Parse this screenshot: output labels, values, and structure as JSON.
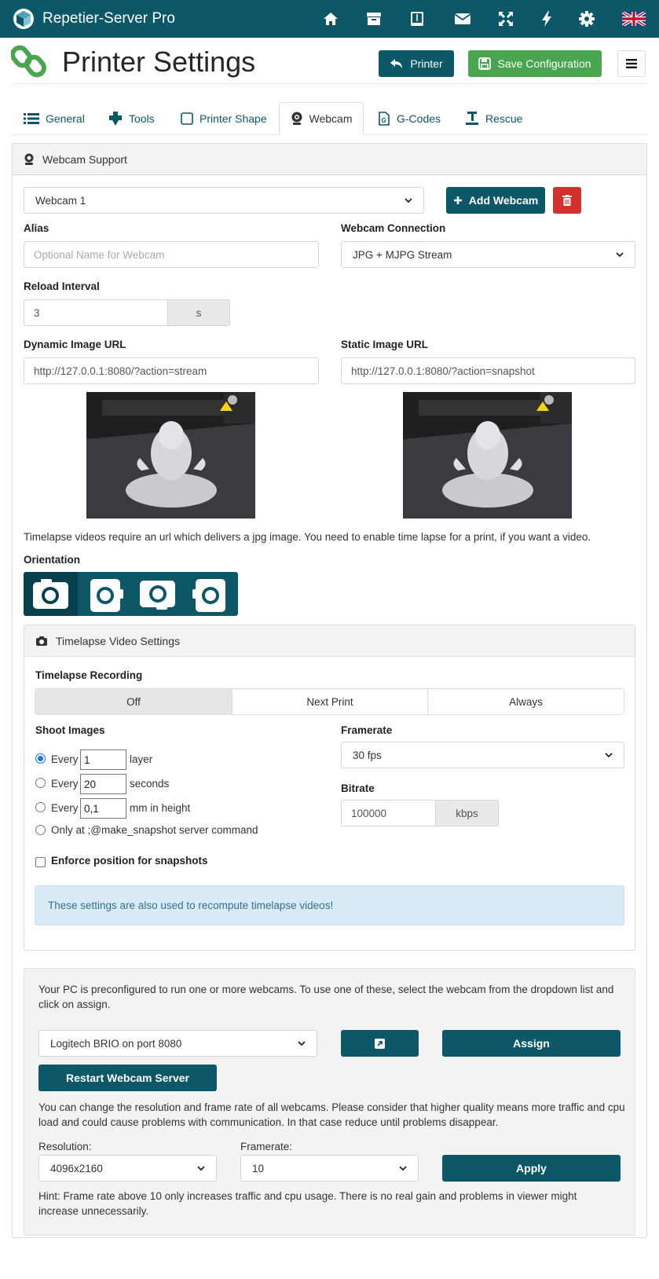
{
  "app": {
    "name": "Repetier-Server Pro"
  },
  "nav": {
    "icons": [
      "home-icon",
      "archive-icon",
      "tablet-icon",
      "mail-icon",
      "fullscreen-icon",
      "bolt-icon",
      "gear-icon",
      "uk-flag-icon"
    ]
  },
  "header": {
    "title": "Printer Settings",
    "printer_label": "Printer",
    "save_label": "Save Configuration"
  },
  "tabs": [
    {
      "label": "General",
      "icon": "list-icon"
    },
    {
      "label": "Tools",
      "icon": "extruder-icon"
    },
    {
      "label": "Printer Shape",
      "icon": "square-icon"
    },
    {
      "label": "Webcam",
      "icon": "webcam-icon",
      "active": true
    },
    {
      "label": "G-Codes",
      "icon": "gcode-file-icon"
    },
    {
      "label": "Rescue",
      "icon": "rescue-icon"
    }
  ],
  "webcam": {
    "panel_title": "Webcam Support",
    "selected": "Webcam 1",
    "add_label": "Add Webcam",
    "alias_label": "Alias",
    "alias_placeholder": "Optional Name for Webcam",
    "connection_label": "Webcam Connection",
    "connection_value": "JPG + MJPG Stream",
    "reload_label": "Reload Interval",
    "reload_value": "3",
    "reload_unit": "s",
    "dynamic_label": "Dynamic Image URL",
    "dynamic_value": "http://127.0.0.1:8080/?action=stream",
    "static_label": "Static Image URL",
    "static_value": "http://127.0.0.1:8080/?action=snapshot",
    "timelapse_note": "Timelapse videos require an url which delivers a jpg image. You need to enable time lapse for a print, if you want a video.",
    "orientation_label": "Orientation"
  },
  "timelapse": {
    "panel_title": "Timelapse Video Settings",
    "recording_label": "Timelapse Recording",
    "recording_options": [
      "Off",
      "Next Print",
      "Always"
    ],
    "recording_selected": "Off",
    "shoot_label": "Shoot Images",
    "every_word": "Every",
    "layer_value": "1",
    "layer_unit": "layer",
    "seconds_value": "20",
    "seconds_unit": "seconds",
    "height_value": "0,1",
    "height_unit": "mm in height",
    "only_at": "Only at ;@make_snapshot server command",
    "framerate_label": "Framerate",
    "framerate_value": "30 fps",
    "bitrate_label": "Bitrate",
    "bitrate_value": "100000",
    "bitrate_unit": "kbps",
    "enforce_label": "Enforce position for snapshots",
    "info": "These settings are also used to recompute timelapse videos!"
  },
  "server": {
    "intro": "Your PC is preconfigured to run one or more webcams. To use one of these, select the webcam from the dropdown list and click on assign.",
    "camera_value": "Logitech BRIO on port 8080",
    "assign_label": "Assign",
    "restart_label": "Restart Webcam Server",
    "resolution_note": "You can change the resolution and frame rate of all webcams. Please consider that higher quality means more traffic and cpu load and could cause problems with communication. In that case reduce until problems disappear.",
    "resolution_label": "Resolution:",
    "resolution_value": "4096x2160",
    "framerate_label": "Framerate:",
    "framerate_value": "10",
    "apply_label": "Apply",
    "hint": "Hint: Frame rate above 10 only increases traffic and cpu usage. There is no real gain and problems in viewer might increase unnecessarily."
  }
}
